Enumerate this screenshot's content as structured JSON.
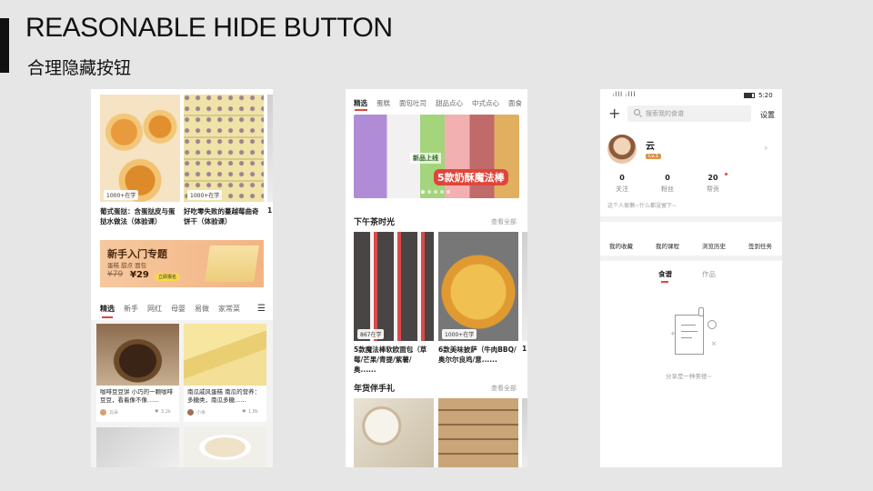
{
  "slide": {
    "title": "REASONABLE HIDE BUTTON",
    "subtitle": "合理隐藏按钮"
  },
  "phone1": {
    "card1": {
      "badge": "1000+在学",
      "title": "葡式蛋挞：含蛋挞皮与蛋挞水做法（体验课）"
    },
    "card2": {
      "badge": "1000+在学",
      "title": "好吃零失败的蔓越莓曲奇饼干（体验课）"
    },
    "card3_peek": "1",
    "promo": {
      "title": "新手入门专题",
      "tags": "蛋糕 甜点 面包",
      "old_price": "¥79",
      "price": "¥29",
      "cta": "立即报名"
    },
    "tabs": [
      "精选",
      "新手",
      "网红",
      "母婴",
      "易做",
      "家常菜"
    ],
    "menu_icon": "menu-icon",
    "feed": [
      {
        "title": "咖啡豆豆饼 小巧的一颗咖啡豆豆，看着像不像......",
        "author": "云朵",
        "likes": "3.2k"
      },
      {
        "title": "南瓜戚风蛋糕 南瓜的营养：多糖类，南瓜多糖......",
        "author": "小余",
        "likes": "1.8k"
      }
    ]
  },
  "phone2": {
    "tabs": [
      "精选",
      "蛋糕",
      "面包吐司",
      "甜品点心",
      "中式点心",
      "面食"
    ],
    "banner_text": "5款奶酥魔法棒",
    "banner_tag": "新品上线",
    "section1": {
      "title": "下午茶时光",
      "more": "查看全部"
    },
    "cards": [
      {
        "badge": "867在学",
        "title": "5款魔法棒软欧面包（草莓/芒果/青提/紫薯/奥......"
      },
      {
        "badge": "1000+在学",
        "title": "6款美味披萨（牛肉BBQ/奥尔尔良鸡/意......"
      }
    ],
    "card_peek": "1",
    "section2": {
      "title": "年货伴手礼",
      "more": "查看全部"
    }
  },
  "phone3": {
    "status": {
      "signal": "ᵢlll ᵢlll",
      "time": "5:20"
    },
    "search_placeholder": "搜索我的食谱",
    "settings": "设置",
    "username": "云",
    "level": "Lv.1",
    "stats": [
      {
        "num": "0",
        "label": "关注"
      },
      {
        "num": "0",
        "label": "粉丝"
      },
      {
        "num": "20",
        "label": "帮贡"
      }
    ],
    "bio": "这个人很懒~什么都没留下~",
    "menu": [
      "我的收藏",
      "我的课程",
      "浏览历史",
      "签到任务"
    ],
    "content_tabs": [
      "食谱",
      "作品"
    ],
    "empty_text": "分享是一种美德~"
  }
}
